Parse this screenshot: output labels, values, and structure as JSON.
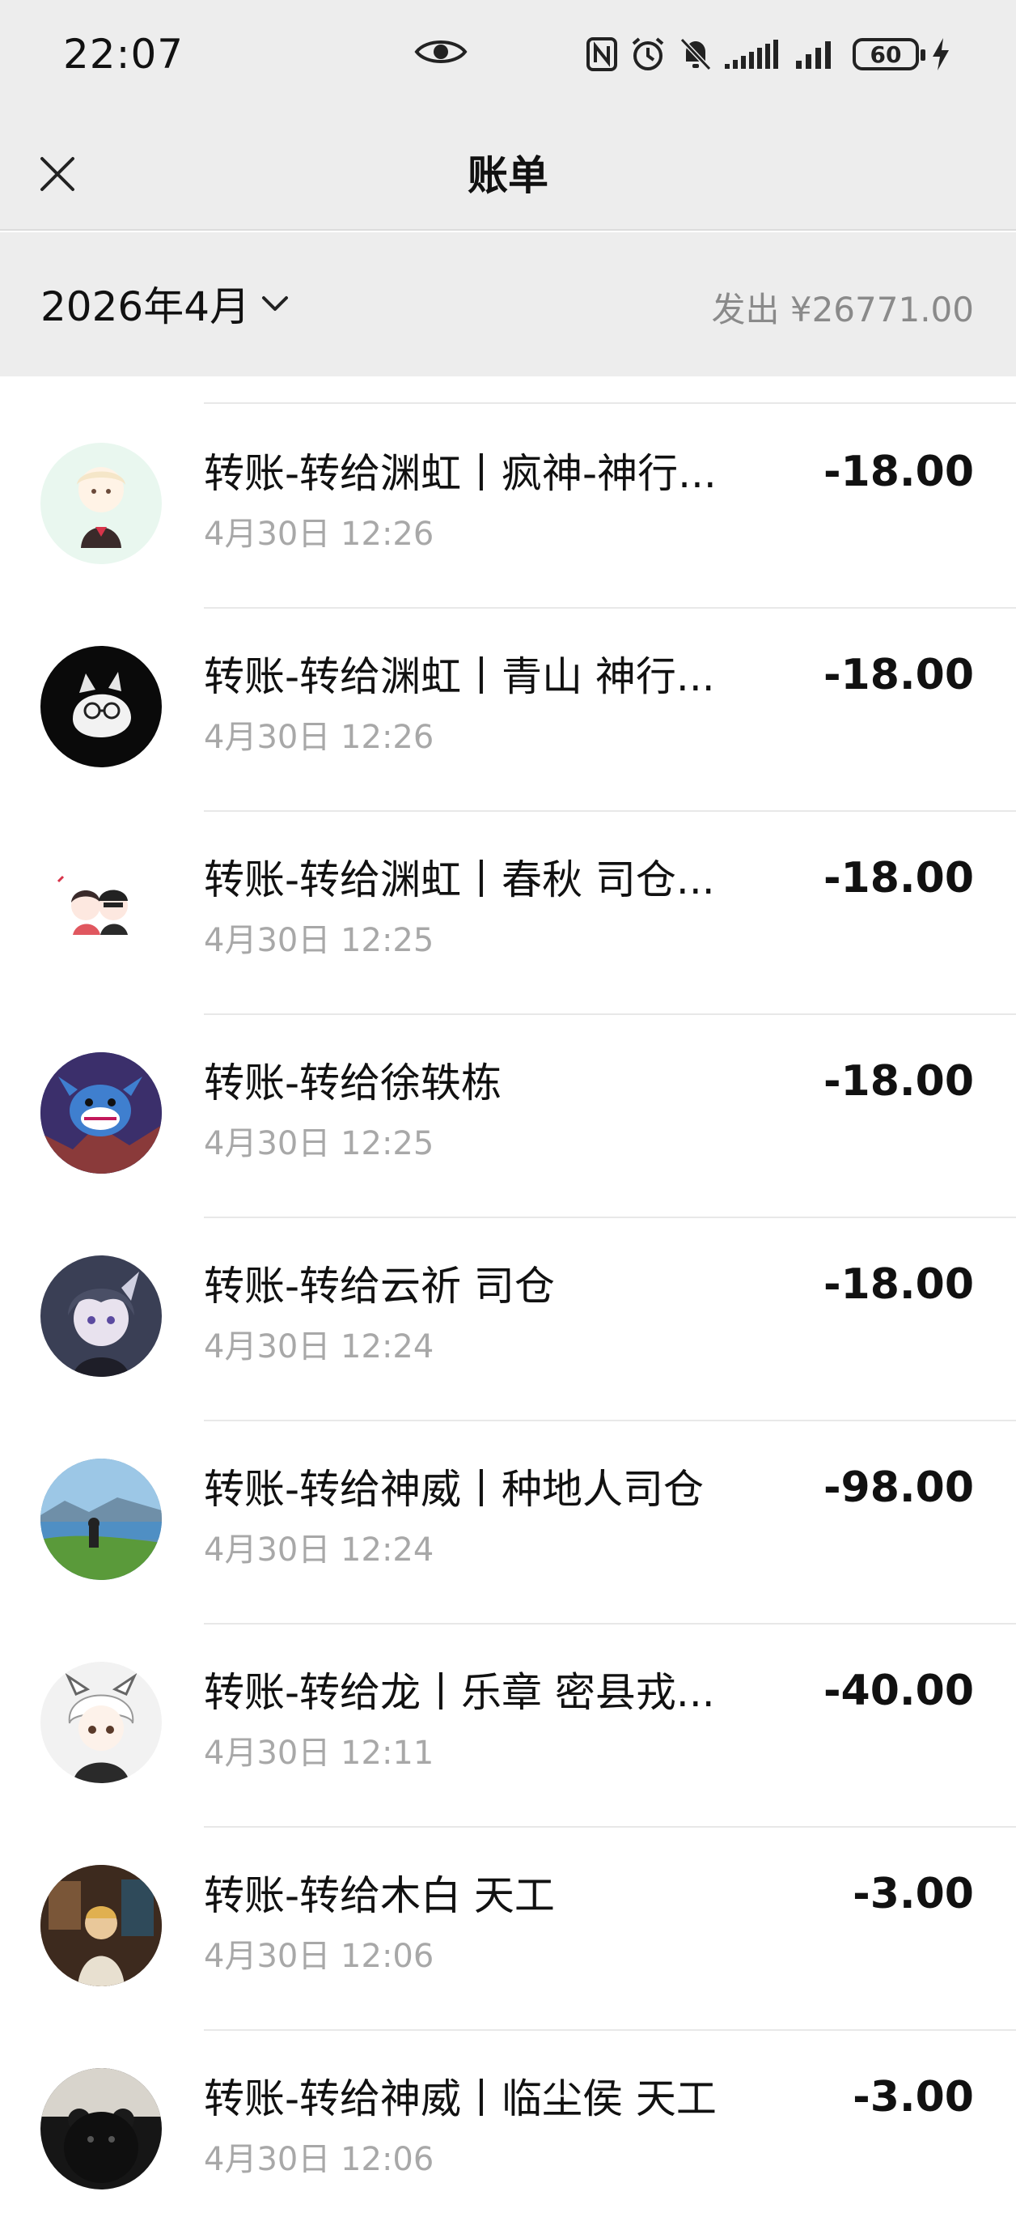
{
  "status_bar": {
    "time": "22:07",
    "battery": "60",
    "icons": [
      "eye-icon",
      "nfc-icon",
      "alarm-icon",
      "mute-icon",
      "signal-icon",
      "signal-icon",
      "battery-icon",
      "charging-icon"
    ]
  },
  "header": {
    "title": "账单",
    "close_icon": "close-icon"
  },
  "filter": {
    "month": "2026年4月",
    "summary": "发出 ¥26771.00"
  },
  "transactions": [
    {
      "title": "转账-转给渊虹丨疯神-神行...",
      "time": "4月30日 12:26",
      "amount": "-18.00",
      "avatar_color": "#e9f7ef"
    },
    {
      "title": "转账-转给渊虹丨青山 神行...",
      "time": "4月30日 12:26",
      "amount": "-18.00",
      "avatar_color": "#0a0a0a"
    },
    {
      "title": "转账-转给渊虹丨春秋 司仓...",
      "time": "4月30日 12:25",
      "amount": "-18.00",
      "avatar_color": "#ffffff"
    },
    {
      "title": "转账-转给徐轶栋",
      "time": "4月30日 12:25",
      "amount": "-18.00",
      "avatar_color": "#2a3a7a"
    },
    {
      "title": "转账-转给云祈 司仓",
      "time": "4月30日 12:24",
      "amount": "-18.00",
      "avatar_color": "#3a3f55"
    },
    {
      "title": "转账-转给神威丨种地人司仓",
      "time": "4月30日 12:24",
      "amount": "-98.00",
      "avatar_color": "#5b8fb5"
    },
    {
      "title": "转账-转给龙丨乐章 密县戎...",
      "time": "4月30日 12:11",
      "amount": "-40.00",
      "avatar_color": "#f2f2f2"
    },
    {
      "title": "转账-转给木白 天工",
      "time": "4月30日 12:06",
      "amount": "-3.00",
      "avatar_color": "#5a3e2b"
    },
    {
      "title": "转账-转给神威丨临尘侯 天工",
      "time": "4月30日 12:06",
      "amount": "-3.00",
      "avatar_color": "#161616"
    }
  ]
}
